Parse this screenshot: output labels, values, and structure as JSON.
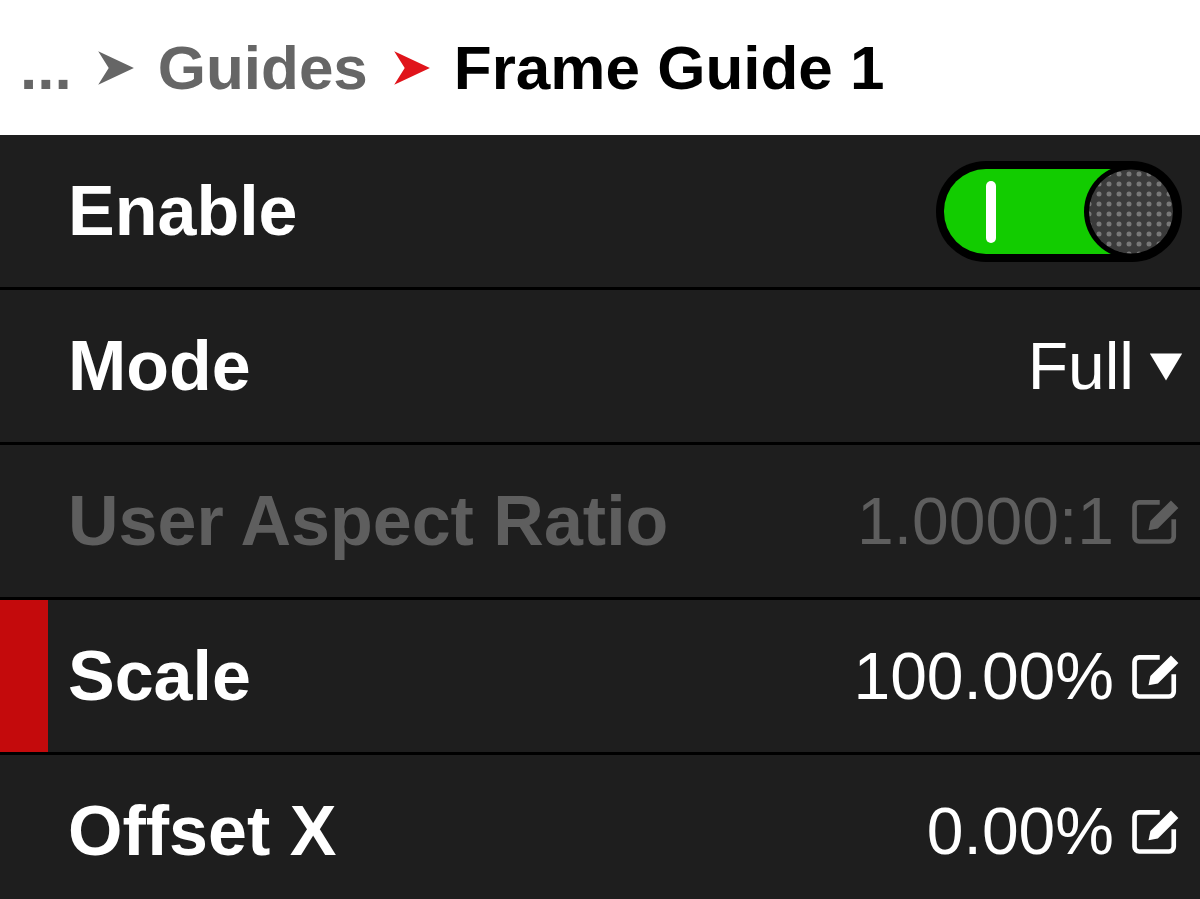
{
  "breadcrumb": [
    {
      "label": "...",
      "current": false
    },
    {
      "label": "Guides",
      "current": false
    },
    {
      "label": "Frame Guide 1",
      "current": true
    }
  ],
  "rows": [
    {
      "kind": "toggle",
      "label": "Enable",
      "on": true,
      "disabled": false,
      "selected": false
    },
    {
      "kind": "dropdown",
      "label": "Mode",
      "value": "Full",
      "disabled": false,
      "selected": false
    },
    {
      "kind": "edit",
      "label": "User Aspect Ratio",
      "value": "1.0000:1",
      "disabled": true,
      "selected": false
    },
    {
      "kind": "edit",
      "label": "Scale",
      "value": "100.00%",
      "disabled": false,
      "selected": true
    },
    {
      "kind": "edit",
      "label": "Offset X",
      "value": "0.00%",
      "disabled": false,
      "selected": false
    }
  ]
}
